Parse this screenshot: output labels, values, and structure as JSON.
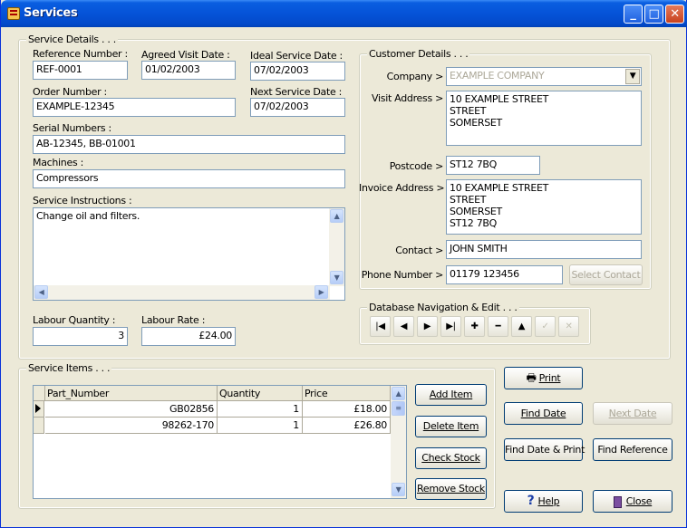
{
  "window": {
    "title": "Services"
  },
  "service_details": {
    "legend": "Service Details . . .",
    "reference_number": {
      "label": "Reference Number :",
      "value": "REF-0001"
    },
    "agreed_visit_date": {
      "label": "Agreed Visit Date :",
      "value": "01/02/2003"
    },
    "ideal_service_date": {
      "label": "Ideal Service Date :",
      "value": "07/02/2003"
    },
    "order_number": {
      "label": "Order Number :",
      "value": "EXAMPLE-12345"
    },
    "next_service_date": {
      "label": "Next Service Date :",
      "value": "07/02/2003"
    },
    "serial_numbers": {
      "label": "Serial Numbers :",
      "value": "AB-12345, BB-01001"
    },
    "machines": {
      "label": "Machines :",
      "value": "Compressors"
    },
    "service_instructions": {
      "label": "Service Instructions :",
      "value": "Change oil and filters."
    },
    "labour_quantity": {
      "label": "Labour Quantity :",
      "value": "3"
    },
    "labour_rate": {
      "label": "Labour Rate :",
      "value": "£24.00"
    }
  },
  "customer_details": {
    "legend": "Customer Details . . .",
    "company": {
      "label": "Company >",
      "value": "EXAMPLE COMPANY"
    },
    "visit_address": {
      "label": "Visit Address >",
      "value": "10 EXAMPLE STREET\nSTREET\nSOMERSET"
    },
    "postcode": {
      "label": "Postcode >",
      "value": "ST12 7BQ"
    },
    "invoice_address": {
      "label": "Invoice Address >",
      "value": "10 EXAMPLE STREET\nSTREET\nSOMERSET\nST12 7BQ"
    },
    "contact": {
      "label": "Contact >",
      "value": "JOHN SMITH"
    },
    "phone_number": {
      "label": "Phone Number >",
      "value": "01179 123456"
    },
    "select_contact_label": "Select Contact"
  },
  "db_nav": {
    "legend": "Database Navigation & Edit . . .",
    "buttons": [
      {
        "name": "first-record-button",
        "glyph": "|◀",
        "enabled": true
      },
      {
        "name": "prev-record-button",
        "glyph": "◀",
        "enabled": true
      },
      {
        "name": "next-record-button",
        "glyph": "▶",
        "enabled": true
      },
      {
        "name": "last-record-button",
        "glyph": "▶|",
        "enabled": true
      },
      {
        "name": "add-record-button",
        "glyph": "✚",
        "enabled": true
      },
      {
        "name": "delete-record-button",
        "glyph": "━",
        "enabled": true
      },
      {
        "name": "edit-record-button",
        "glyph": "▲",
        "enabled": true
      },
      {
        "name": "post-edit-button",
        "glyph": "✓",
        "enabled": false
      },
      {
        "name": "cancel-edit-button",
        "glyph": "✕",
        "enabled": false
      }
    ]
  },
  "service_items": {
    "legend": "Service Items . . .",
    "columns": [
      "Part_Number",
      "Quantity",
      "Price"
    ],
    "rows": [
      {
        "part_number": "GB02856",
        "quantity": "1",
        "price": "£18.00"
      },
      {
        "part_number": "98262-170",
        "quantity": "1",
        "price": "£26.80"
      }
    ],
    "add_item_label": "Add Item",
    "delete_item_label": "Delete Item",
    "check_stock_label": "Check Stock",
    "remove_stock_label": "Remove Stock"
  },
  "actions": {
    "print_label": "Print",
    "find_date_label": "Find Date",
    "next_date_label": "Next Date",
    "find_date_print_label": "Find Date & Print",
    "find_reference_label": "Find Reference",
    "help_label": "Help",
    "close_label": "Close"
  },
  "colors": {
    "titlebar": "#0553d8",
    "face": "#ece9d8",
    "field_border": "#7f9db9"
  }
}
